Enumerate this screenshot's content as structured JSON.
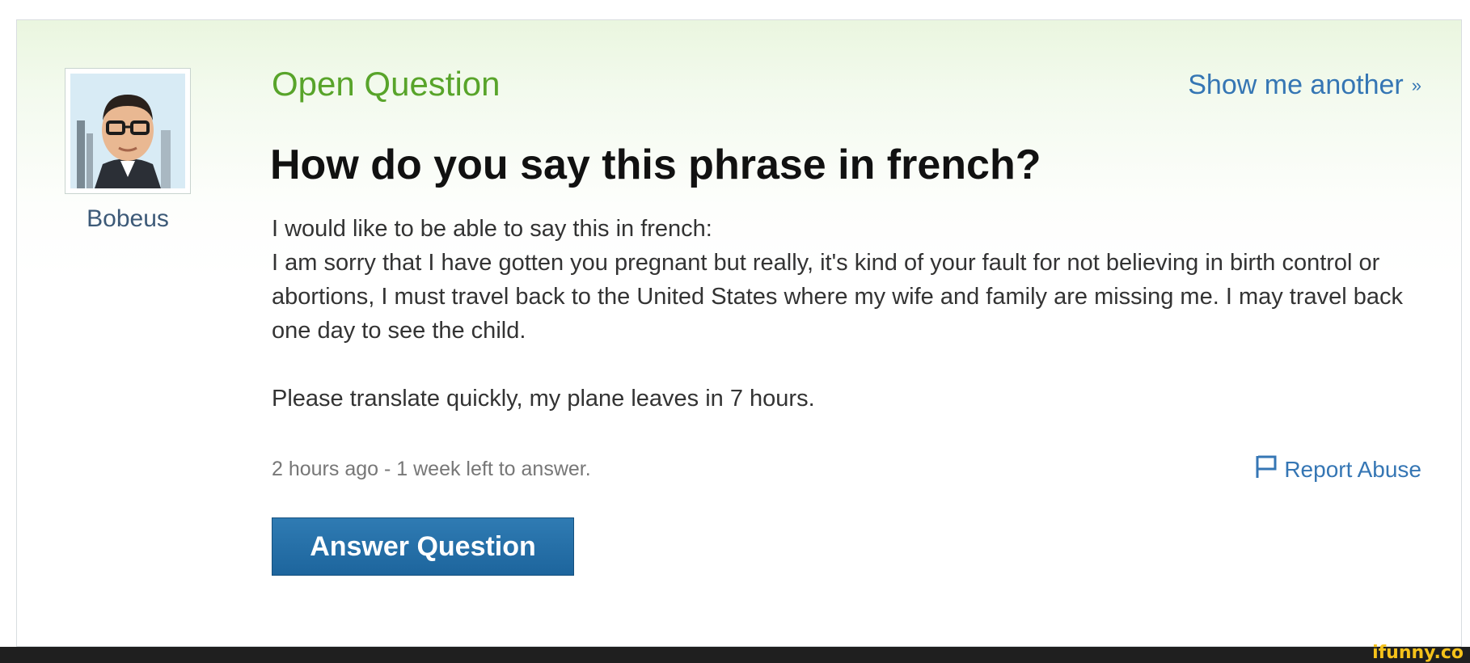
{
  "user": {
    "name": "Bobeus"
  },
  "header": {
    "status_label": "Open Question",
    "show_another_label": "Show me another",
    "show_another_icon": "double-chevron-right-icon"
  },
  "question": {
    "title": "How do you say this phrase in french?",
    "body_lines": [
      "I would like to be able to say this in french:",
      "I am sorry that I have gotten you pregnant but really, it's kind of your fault for not believing in birth control or abortions, I must travel back to the United States where my wife and family are missing me. I may travel back one day to see the child.",
      "Please translate quickly, my plane leaves in 7 hours."
    ],
    "meta": "2 hours ago - 1 week left to answer.",
    "report_label": "Report Abuse",
    "report_icon": "flag-icon"
  },
  "actions": {
    "answer_label": "Answer Question"
  },
  "colors": {
    "status_green": "#58a42a",
    "link_blue": "#3576b4",
    "button_blue": "#1d659d"
  },
  "watermark": "ifunny.co"
}
